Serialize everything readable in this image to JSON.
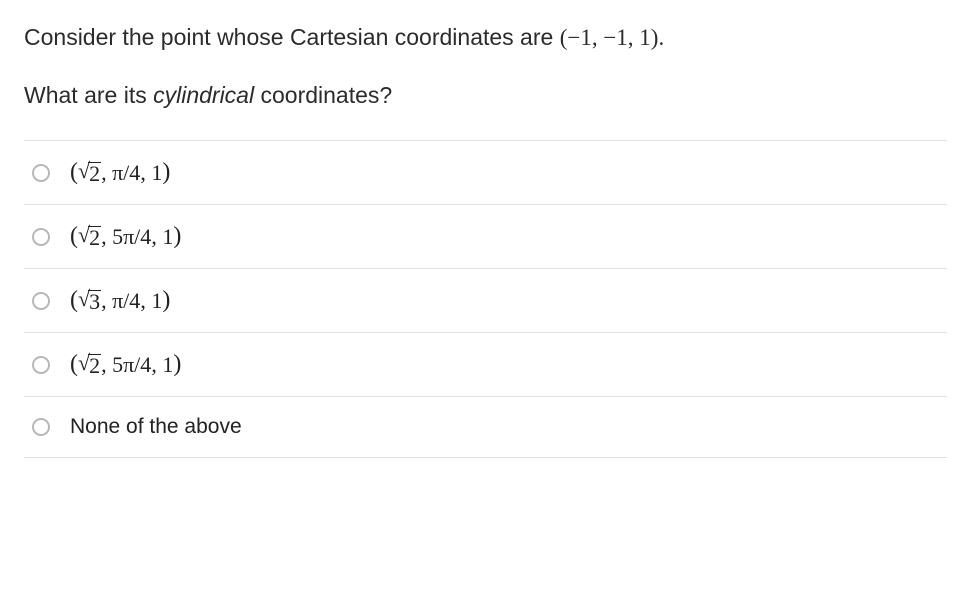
{
  "question": {
    "prefix": "Consider the point whose Cartesian coordinates are ",
    "coords": "(−1, −1, 1).",
    "line2_a": "What are its ",
    "line2_em": "cylindrical",
    "line2_b": " coordinates?"
  },
  "options": [
    {
      "sqrtArg": "2",
      "angle": "π/4",
      "z": "1",
      "plain": null
    },
    {
      "sqrtArg": "2",
      "angle": "5π/4",
      "z": "1",
      "plain": null
    },
    {
      "sqrtArg": "3",
      "angle": "π/4",
      "z": "1",
      "plain": null
    },
    {
      "sqrtArg": "2",
      "angle": "5π/4",
      "z": "1",
      "plain": null
    },
    {
      "sqrtArg": null,
      "angle": null,
      "z": null,
      "plain": "None of the above"
    }
  ]
}
